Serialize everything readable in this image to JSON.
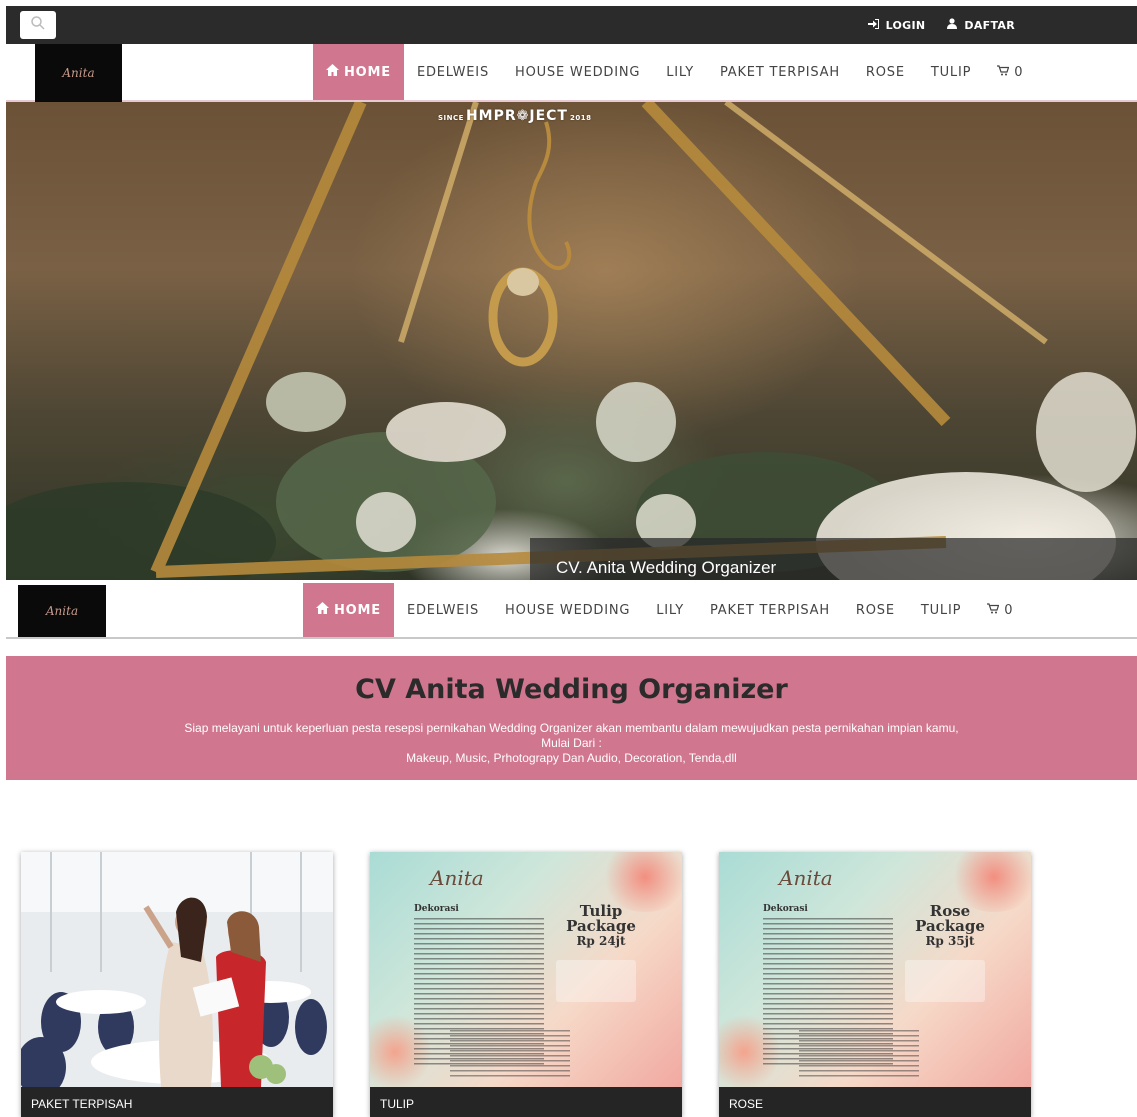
{
  "topbar": {
    "search_icon": "search-icon",
    "login_label": "LOGIN",
    "login_icon": "sign-in-icon",
    "register_label": "DAFTAR",
    "register_icon": "user-icon"
  },
  "logo": {
    "text": "Anita"
  },
  "nav": {
    "home_icon": "home-icon",
    "items": [
      "HOME",
      "EDELWEIS",
      "HOUSE WEDDING",
      "LILY",
      "PAKET TERPISAH",
      "ROSE",
      "TULIP"
    ],
    "cart_icon": "cart-icon",
    "cart_count": "0",
    "active_color": "#d0768f"
  },
  "hero": {
    "watermark_since": "SINCE",
    "watermark_main": "HMPR❁JECT",
    "watermark_year": "2018",
    "caption": "CV. Anita Wedding Organizer"
  },
  "banner": {
    "title": "CV Anita Wedding Organizer",
    "line1": "Siap melayani untuk keperluan pesta resepsi pernikahan Wedding Organizer akan membantu dalam mewujudkan pesta pernikahan impian kamu,",
    "line2": "Mulai Dari :",
    "line3": "Makeup, Music, Prhotograpy Dan Audio, Decoration, Tenda,dll",
    "color": "#d0768f"
  },
  "cards": [
    {
      "label": "PAKET TERPISAH"
    },
    {
      "label": "TULIP",
      "poster": {
        "brand": "Anita",
        "package_name": "Tulip",
        "package_word": "Package",
        "price": "Rp 24jt",
        "heading": "Dekorasi"
      }
    },
    {
      "label": "ROSE",
      "poster": {
        "brand": "Anita",
        "package_name": "Rose",
        "package_word": "Package",
        "price": "Rp 35jt",
        "heading": "Dekorasi"
      }
    }
  ]
}
